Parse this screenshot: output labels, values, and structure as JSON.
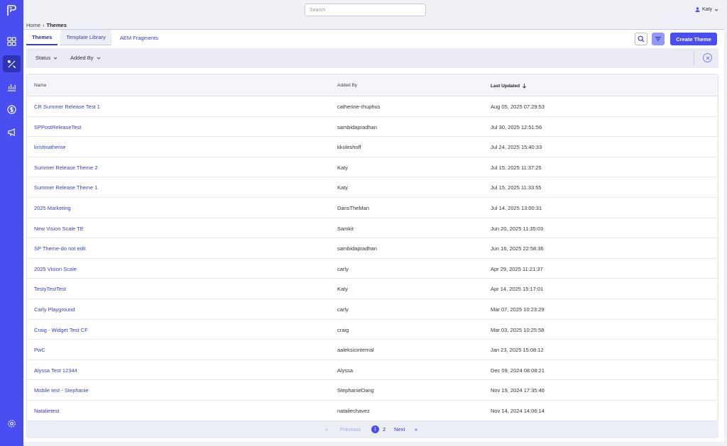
{
  "topbar": {
    "search_placeholder": "Search",
    "user_name": "Katy"
  },
  "breadcrumb": {
    "home": "Home",
    "separator": "›",
    "current": "Themes"
  },
  "tabs": [
    {
      "label": "Themes",
      "active": true
    },
    {
      "label": "Template Library",
      "active": false
    },
    {
      "label": "AEM Fragments",
      "active": false
    }
  ],
  "toolbar": {
    "create_label": "Create Theme"
  },
  "filters": {
    "status_label": "Status",
    "added_by_label": "Added By"
  },
  "table": {
    "columns": {
      "name": "Name",
      "added_by": "Added By",
      "last_updated": "Last Updated"
    },
    "rows": [
      {
        "name": "CR Summer Release Test 1",
        "added_by": "catherine-rhuphus",
        "last_updated": "Aug 05, 2025 07:29:53"
      },
      {
        "name": "SPPostReleaseTest",
        "added_by": "sambidapradhan",
        "last_updated": "Jul 30, 2025 12:51:56"
      },
      {
        "name": "kristinatheme",
        "added_by": "kkuleshoff",
        "last_updated": "Jul 24, 2025 15:40:33"
      },
      {
        "name": "Summer Release Theme 2",
        "added_by": "Katy",
        "last_updated": "Jul 15, 2025 11:37:25"
      },
      {
        "name": "Summer Release Theme 1",
        "added_by": "Katy",
        "last_updated": "Jul 15, 2025 11:33:55"
      },
      {
        "name": "2025 Marketing",
        "added_by": "DansTheMan",
        "last_updated": "Jul 14, 2025 13:00:31"
      },
      {
        "name": "New Vision Scale TE",
        "added_by": "Samkit",
        "last_updated": "Jun 20, 2025 11:35:03"
      },
      {
        "name": "SP Theme-do not edit",
        "added_by": "sambidapradhan",
        "last_updated": "Jun 16, 2025 22:58:36"
      },
      {
        "name": "2025 Vision Scale",
        "added_by": "carly",
        "last_updated": "Apr 29, 2025 11:21:37"
      },
      {
        "name": "TestyTestTest",
        "added_by": "Katy",
        "last_updated": "Apr 14, 2025 15:17:01"
      },
      {
        "name": "Carly Playground",
        "added_by": "carly",
        "last_updated": "Mar 07, 2025 10:23:29"
      },
      {
        "name": "Craig - Widget Test CF",
        "added_by": "craig",
        "last_updated": "Mar 03, 2025 10:25:58"
      },
      {
        "name": "PwC",
        "added_by": "aaleksicinternal",
        "last_updated": "Jan 23, 2025 15:08:12"
      },
      {
        "name": "Alyssa Test 12344",
        "added_by": "Alyssa",
        "last_updated": "Dec 09, 2024 08:08:21"
      },
      {
        "name": "Mobile test - Stephanie",
        "added_by": "StephanieDang",
        "last_updated": "Nov 19, 2024 17:35:46"
      },
      {
        "name": "Natalietest",
        "added_by": "nataliechavez",
        "last_updated": "Nov 14, 2024 14:06:14"
      }
    ]
  },
  "pagination": {
    "first": "«",
    "previous": "Previous",
    "current_page": "1",
    "page_2": "2",
    "next": "Next",
    "last": "»"
  },
  "colors": {
    "accent": "#4a4ef0",
    "link": "#3a3fc4"
  }
}
